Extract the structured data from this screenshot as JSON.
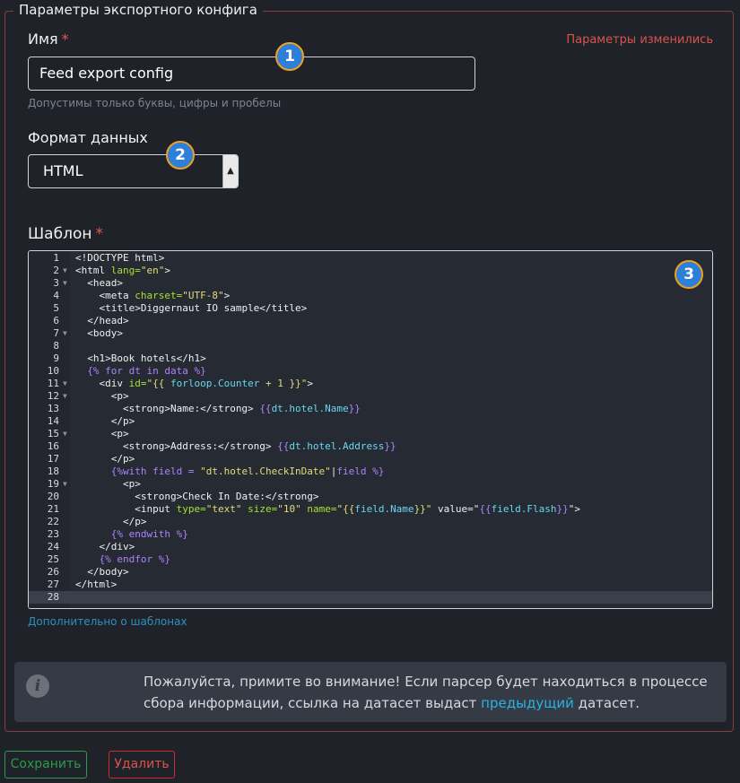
{
  "form": {
    "legend": "Параметры экспортного конфига",
    "changed_notice": "Параметры изменились",
    "name_label": "Имя",
    "required_mark": "*",
    "name_value": "Feed export config",
    "name_hint": "Допустимы только буквы, цифры и пробелы",
    "format_label": "Формат данных",
    "format_value": "HTML",
    "template_label": "Шаблон",
    "more_link": "Дополнительно о шаблонах"
  },
  "badges": [
    "1",
    "2",
    "3"
  ],
  "editor": {
    "active_line": 28,
    "lines": [
      {
        "n": "1",
        "fold": false,
        "indent": 0,
        "tokens": [
          [
            "t",
            "<!DOCTYPE html>"
          ]
        ]
      },
      {
        "n": "2",
        "fold": true,
        "indent": 0,
        "tokens": [
          [
            "t",
            "<html "
          ],
          [
            "a",
            "lang="
          ],
          [
            "s",
            "\"en\""
          ],
          [
            "t",
            ">"
          ]
        ]
      },
      {
        "n": "3",
        "fold": true,
        "indent": 2,
        "tokens": [
          [
            "t",
            "<head>"
          ]
        ]
      },
      {
        "n": "4",
        "fold": false,
        "indent": 4,
        "tokens": [
          [
            "t",
            "<meta "
          ],
          [
            "a",
            "charset="
          ],
          [
            "s",
            "\"UTF-8\""
          ],
          [
            "t",
            ">"
          ]
        ]
      },
      {
        "n": "5",
        "fold": false,
        "indent": 4,
        "tokens": [
          [
            "t",
            "<title>Diggernaut IO sample</title>"
          ]
        ]
      },
      {
        "n": "6",
        "fold": false,
        "indent": 2,
        "tokens": [
          [
            "t",
            "</head>"
          ]
        ]
      },
      {
        "n": "7",
        "fold": true,
        "indent": 2,
        "tokens": [
          [
            "t",
            "<body>"
          ]
        ]
      },
      {
        "n": "8",
        "fold": false,
        "indent": 0,
        "tokens": []
      },
      {
        "n": "9",
        "fold": false,
        "indent": 2,
        "tokens": [
          [
            "t",
            "<h1>Book hotels</h1>"
          ]
        ]
      },
      {
        "n": "10",
        "fold": false,
        "indent": 2,
        "tokens": [
          [
            "p",
            "{% for dt in data %}"
          ]
        ]
      },
      {
        "n": "11",
        "fold": true,
        "indent": 4,
        "tokens": [
          [
            "t",
            "<div "
          ],
          [
            "a",
            "id="
          ],
          [
            "s",
            "\"{{ "
          ],
          [
            "v",
            "forloop.Counter"
          ],
          [
            "s",
            " + 1 }}\""
          ],
          [
            "t",
            ">"
          ]
        ]
      },
      {
        "n": "12",
        "fold": true,
        "indent": 6,
        "tokens": [
          [
            "t",
            "<p>"
          ]
        ]
      },
      {
        "n": "13",
        "fold": false,
        "indent": 8,
        "tokens": [
          [
            "t",
            "<strong>Name:</strong> "
          ],
          [
            "p",
            "{{"
          ],
          [
            "v",
            "dt.hotel.Name"
          ],
          [
            "p",
            "}}"
          ]
        ]
      },
      {
        "n": "14",
        "fold": false,
        "indent": 6,
        "tokens": [
          [
            "t",
            "</p>"
          ]
        ]
      },
      {
        "n": "15",
        "fold": true,
        "indent": 6,
        "tokens": [
          [
            "t",
            "<p>"
          ]
        ]
      },
      {
        "n": "16",
        "fold": false,
        "indent": 8,
        "tokens": [
          [
            "t",
            "<strong>Address:</strong> "
          ],
          [
            "p",
            "{{"
          ],
          [
            "v",
            "dt.hotel.Address"
          ],
          [
            "p",
            "}}"
          ]
        ]
      },
      {
        "n": "17",
        "fold": false,
        "indent": 6,
        "tokens": [
          [
            "t",
            "</p>"
          ]
        ]
      },
      {
        "n": "18",
        "fold": false,
        "indent": 6,
        "tokens": [
          [
            "p",
            "{%with field = "
          ],
          [
            "s",
            "\"dt.hotel.CheckInDate\""
          ],
          [
            "t",
            "|"
          ],
          [
            "p",
            "field %}"
          ]
        ]
      },
      {
        "n": "19",
        "fold": true,
        "indent": 8,
        "tokens": [
          [
            "t",
            "<p>"
          ]
        ]
      },
      {
        "n": "20",
        "fold": false,
        "indent": 10,
        "tokens": [
          [
            "t",
            "<strong>Check In Date:</strong>"
          ]
        ]
      },
      {
        "n": "21",
        "fold": false,
        "indent": 10,
        "tokens": [
          [
            "t",
            "<input "
          ],
          [
            "a",
            "type="
          ],
          [
            "s",
            "\"text\" "
          ],
          [
            "a",
            "size="
          ],
          [
            "s",
            "\"10\" "
          ],
          [
            "a",
            "name="
          ],
          [
            "s",
            "\"{{"
          ],
          [
            "v",
            "field.Name"
          ],
          [
            "s",
            "}}\""
          ],
          [
            "t",
            " value=\""
          ],
          [
            "p",
            "{{"
          ],
          [
            "v",
            "field.Flash"
          ],
          [
            "p",
            "}}"
          ],
          [
            "t",
            "\">"
          ]
        ]
      },
      {
        "n": "22",
        "fold": false,
        "indent": 8,
        "tokens": [
          [
            "t",
            "</p>"
          ]
        ]
      },
      {
        "n": "23",
        "fold": false,
        "indent": 6,
        "tokens": [
          [
            "p",
            "{% endwith %}"
          ]
        ]
      },
      {
        "n": "24",
        "fold": false,
        "indent": 4,
        "tokens": [
          [
            "t",
            "</div>"
          ]
        ]
      },
      {
        "n": "25",
        "fold": false,
        "indent": 4,
        "tokens": [
          [
            "p",
            "{% endfor %}"
          ]
        ]
      },
      {
        "n": "26",
        "fold": false,
        "indent": 2,
        "tokens": [
          [
            "t",
            "</body>"
          ]
        ]
      },
      {
        "n": "27",
        "fold": false,
        "indent": 0,
        "tokens": [
          [
            "t",
            "</html>"
          ]
        ]
      },
      {
        "n": "28",
        "fold": false,
        "indent": 0,
        "tokens": []
      }
    ]
  },
  "notice": {
    "text_before": "Пожалуйста, примите во внимание! Если парсер будет находиться в процессе сбора информации, ссылка на датасет выдаст ",
    "link": "предыдущий",
    "text_after": " датасет.",
    "icon": "info-icon"
  },
  "buttons": {
    "save": "Сохранить",
    "delete": "Удалить"
  },
  "colors": {
    "border": "#8a3c3c",
    "required": "#e05a4f",
    "save": "#2c9a4a",
    "delete": "#c9302c",
    "link": "#2bb1e6"
  }
}
